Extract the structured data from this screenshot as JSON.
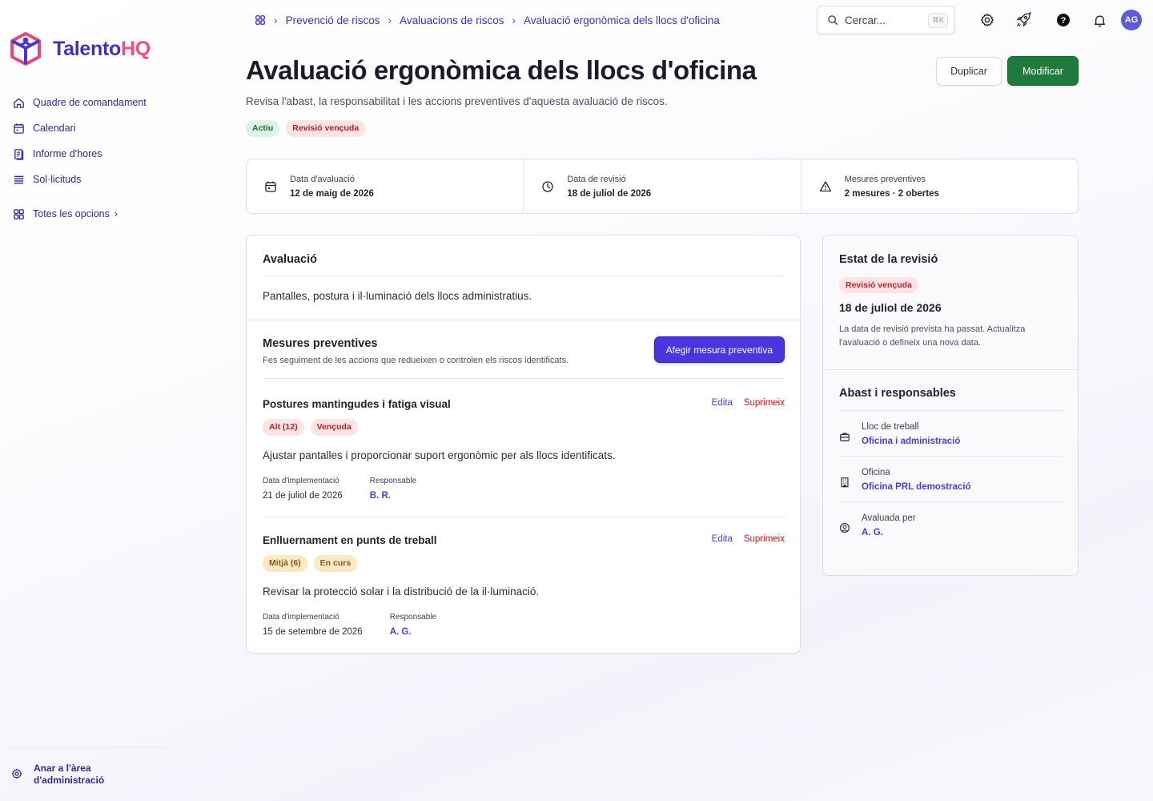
{
  "brand": {
    "name_main": "Talento",
    "name_accent": "HQ"
  },
  "sidebar": {
    "items": [
      {
        "label": "Quadre de comandament",
        "icon": "home-icon"
      },
      {
        "label": "Calendari",
        "icon": "calendar-icon"
      },
      {
        "label": "Informe d'hores",
        "icon": "report-icon"
      },
      {
        "label": "Sol·licituds",
        "icon": "list-icon"
      }
    ],
    "more_label": "Totes les opcions",
    "admin_label": "Anar a l'àrea d'administració"
  },
  "breadcrumb": [
    "Prevenció de riscos",
    "Avaluacions de riscos",
    "Avaluació ergonòmica dels llocs d'oficina"
  ],
  "search": {
    "placeholder": "Cercar...",
    "shortcut": "⌘K"
  },
  "user": {
    "initials": "AG"
  },
  "header": {
    "title": "Avaluació ergonòmica dels llocs d'oficina",
    "subtitle": "Revisa l'abast, la responsabilitat i les accions preventives d'aquesta avaluació de riscos.",
    "badges": [
      "Actiu",
      "Revisió vençuda"
    ],
    "duplicate_label": "Duplicar",
    "edit_label": "Modificar"
  },
  "stats": [
    {
      "label": "Data d'avaluació",
      "value": "12 de maig de 2026",
      "icon": "calendar-icon"
    },
    {
      "label": "Data de revisió",
      "value": "18 de juliol de 2026",
      "icon": "clock-icon"
    },
    {
      "label": "Mesures preventives",
      "value": "2 mesures · 2 obertes",
      "icon": "warning-icon"
    }
  ],
  "evaluation": {
    "heading": "Avaluació",
    "text": "Pantalles, postura i il·luminació dels llocs administratius."
  },
  "measures_section": {
    "heading": "Mesures preventives",
    "description": "Fes seguiment de les accions que redueixen o controlen els riscos identificats.",
    "add_label": "Afegir mesura preventiva",
    "edit_label": "Edita",
    "delete_label": "Suprimeix",
    "date_label": "Data d'implementació",
    "owner_label": "Responsable",
    "items": [
      {
        "title": "Postures mantingudes i fatiga visual",
        "risk": "Alt (12)",
        "status": "Vençuda",
        "text": "Ajustar pantalles i proporcionar suport ergonòmic per als llocs identificats.",
        "date": "21 de juliol de 2026",
        "owner": "B. R."
      },
      {
        "title": "Enlluernament en punts de treball",
        "risk": "Mitjà (6)",
        "status": "En curs",
        "text": "Revisar la protecció solar i la distribució de la il·luminació.",
        "date": "15 de setembre de 2026",
        "owner": "A. G."
      }
    ]
  },
  "review": {
    "heading": "Estat de la revisió",
    "badge": "Revisió vençuda",
    "date": "18 de juliol de 2026",
    "note": "La data de revisió prevista ha passat. Actualitza l'avaluació o defineix una nova data."
  },
  "scope": {
    "heading": "Abast i responsables",
    "rows": [
      {
        "label": "Lloc de treball",
        "value": "Oficina i administració",
        "icon": "briefcase-icon"
      },
      {
        "label": "Oficina",
        "value": "Oficina PRL demostració",
        "icon": "building-icon"
      },
      {
        "label": "Avaluada per",
        "value": "A. G.",
        "icon": "user-icon"
      }
    ]
  }
}
